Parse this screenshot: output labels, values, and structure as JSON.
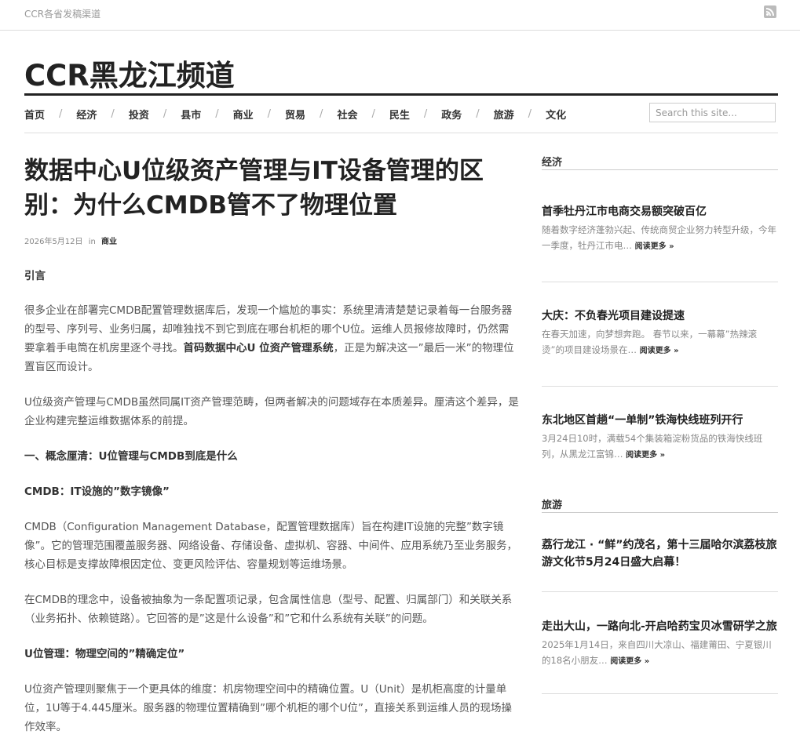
{
  "topbar": {
    "link": "CCR各省发稿渠道",
    "rss_icon": "rss-icon"
  },
  "site": {
    "title": "CCR黑龙江频道"
  },
  "nav": {
    "items": [
      "首页",
      "经济",
      "投资",
      "县市",
      "商业",
      "贸易",
      "社会",
      "民生",
      "政务",
      "旅游",
      "文化"
    ],
    "separator": "/",
    "search_placeholder": "Search this site..."
  },
  "article": {
    "title": "数据中心U位级资产管理与IT设备管理的区别：为什么CMDB管不了物理位置",
    "date": "2026年5月12日",
    "in": "in",
    "category": "商业",
    "intro_heading": "引言",
    "p1_a": "很多企业在部署完CMDB配置管理数据库后，发现一个尴尬的事实：系统里清清楚楚记录着每一台服务器的型号、序列号、业务归属，却唯独找不到它到底在哪台机柜的哪个U位。运维人员报修故障时，仍然需要拿着手电筒在机房里逐个寻找。",
    "p1_b": "首码数据中心U 位资产管理系统",
    "p1_c": "，正是为解决这一”最后一米”的物理位置盲区而设计。",
    "p2": "U位级资产管理与CMDB虽然同属IT资产管理范畴，但两者解决的问题域存在本质差异。厘清这个差异，是企业构建完整运维数据体系的前提。",
    "h1": "一、概念厘清：U位管理与CMDB到底是什么",
    "h2": "CMDB：IT设施的”数字镜像”",
    "p3": "CMDB（Configuration Management Database，配置管理数据库）旨在构建IT设施的完整”数字镜像”。它的管理范围覆盖服务器、网络设备、存储设备、虚拟机、容器、中间件、应用系统乃至业务服务，核心目标是支撑故障根因定位、变更风险评估、容量规划等运维场景。",
    "p4": "在CMDB的理念中，设备被抽象为一条配置项记录，包含属性信息（型号、配置、归属部门）和关联关系（业务拓扑、依赖链路）。它回答的是”这是什么设备”和”它和什么系统有关联”的问题。",
    "h3": "U位管理：物理空间的”精确定位”",
    "p5": "U位资产管理则聚焦于一个更具体的维度：机房物理空间中的精确位置。U（Unit）是机柜高度的计量单位，1U等于4.445厘米。服务器的物理位置精确到”哪个机柜的哪个U位”，直接关系到运维人员的现场操作效率。"
  },
  "sidebar": {
    "readmore": "阅读更多 »",
    "widget1_title": "经济",
    "widget1_posts": [
      {
        "title": "首季牡丹江市电商交易额突破百亿",
        "excerpt": "随着数字经济蓬勃兴起、传统商贸企业努力转型升级，今年一季度，牡丹江市电…"
      },
      {
        "title": "大庆：不负春光项目建设提速",
        "excerpt": "在春天加速，向梦想奔跑。 春节以来，一幕幕”热辣滚烫”的项目建设场景在…"
      },
      {
        "title": "东北地区首趟“一单制”铁海快线班列开行",
        "excerpt": "3月24日10时，满载54个集装箱淀粉货品的铁海快线班列，从黑龙江富锦…"
      }
    ],
    "widget2_title": "旅游",
    "widget2_posts": [
      {
        "title": "荔行龙江 · “鲜”约茂名，第十三届哈尔滨荔枝旅游文化节5月24日盛大启幕！",
        "excerpt": ""
      },
      {
        "title": "走出大山，一路向北-开启哈药宝贝冰雪研学之旅",
        "excerpt": "2025年1月14日，来自四川大凉山、福建莆田、宁夏银川的18名小朋友…"
      }
    ]
  }
}
